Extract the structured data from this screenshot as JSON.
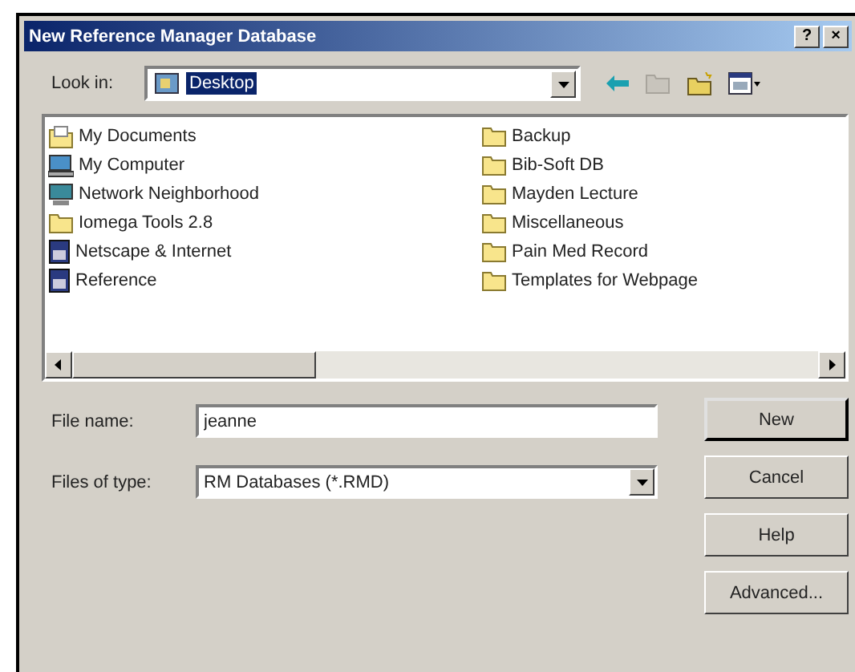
{
  "window": {
    "title": "New Reference Manager Database",
    "help_button": "?",
    "close_button": "×"
  },
  "look_in": {
    "label": "Look in:",
    "value": "Desktop",
    "highlighted": true
  },
  "files": [
    {
      "name": "My Documents",
      "kind": "documents"
    },
    {
      "name": "My Computer",
      "kind": "computer"
    },
    {
      "name": "Network Neighborhood",
      "kind": "network"
    },
    {
      "name": "Iomega Tools 2.8",
      "kind": "folder"
    },
    {
      "name": "Netscape & Internet",
      "kind": "program"
    },
    {
      "name": "Reference",
      "kind": "program"
    },
    {
      "name": "Backup",
      "kind": "folder"
    },
    {
      "name": "Bib-Soft DB",
      "kind": "folder"
    },
    {
      "name": "Mayden Lecture",
      "kind": "folder"
    },
    {
      "name": "Miscellaneous",
      "kind": "folder"
    },
    {
      "name": "Pain Med Record",
      "kind": "folder"
    },
    {
      "name": "Templates for Webpage",
      "kind": "folder"
    }
  ],
  "file_name": {
    "label": "File name:",
    "value": "jeanne"
  },
  "file_type": {
    "label": "Files of type:",
    "value": "RM Databases (*.RMD)"
  },
  "buttons": [
    {
      "label": "New",
      "default": true
    },
    {
      "label": "Cancel",
      "default": false
    },
    {
      "label": "Help",
      "default": false
    },
    {
      "label": "Advanced...",
      "default": false
    }
  ]
}
